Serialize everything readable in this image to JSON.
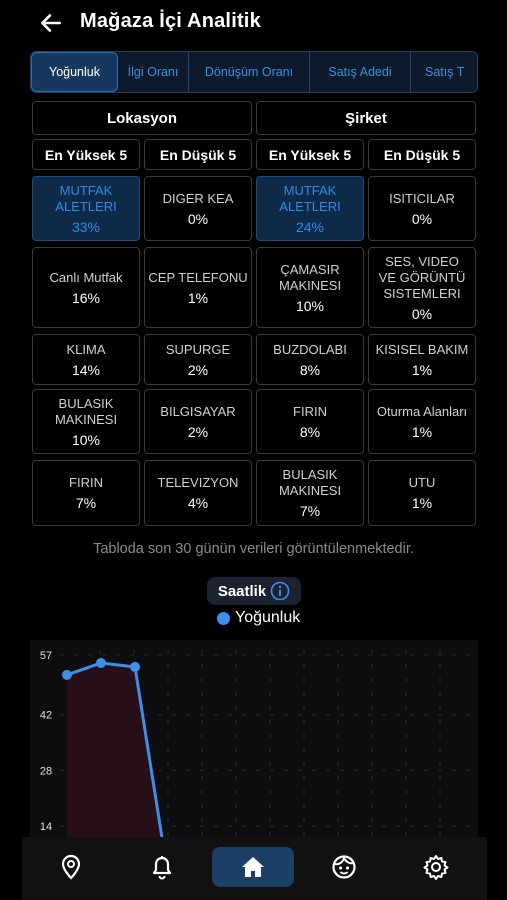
{
  "header": {
    "title": "Mağaza İçi Analitik"
  },
  "tabs": [
    {
      "label": "Yoğunluk",
      "active": true
    },
    {
      "label": "İlgi Oranı"
    },
    {
      "label": "Dönüşüm Oranı"
    },
    {
      "label": "Satış Adedi"
    },
    {
      "label": "Satış T"
    }
  ],
  "table": {
    "groups": [
      "Lokasyon",
      "Şirket"
    ],
    "subheads": [
      "En Yüksek 5",
      "En Düşük 5",
      "En Yüksek 5",
      "En Düşük 5"
    ],
    "rows": [
      [
        {
          "name": "MUTFAK\nALETLERI",
          "val": "33%",
          "hl": true
        },
        {
          "name": "DIGER KEA",
          "val": "0%"
        },
        {
          "name": "MUTFAK\nALETLERI",
          "val": "24%",
          "hl": true
        },
        {
          "name": "ISITICILAR",
          "val": "0%"
        }
      ],
      [
        {
          "name": "Canlı Mutfak",
          "val": "16%"
        },
        {
          "name": "CEP TELEFONU",
          "val": "1%"
        },
        {
          "name": "ÇAMASIR\nMAKINESI",
          "val": "10%"
        },
        {
          "name": "SES, VIDEO\nVE GÖRÜNTÜ\nSISTEMLERI",
          "val": "0%"
        }
      ],
      [
        {
          "name": "KLIMA",
          "val": "14%"
        },
        {
          "name": "SUPURGE",
          "val": "2%"
        },
        {
          "name": "BUZDOLABI",
          "val": "8%"
        },
        {
          "name": "KISISEL BAKIM",
          "val": "1%"
        }
      ],
      [
        {
          "name": "BULASIK\nMAKINESI",
          "val": "10%"
        },
        {
          "name": "BILGISAYAR",
          "val": "2%"
        },
        {
          "name": "FIRIN",
          "val": "8%"
        },
        {
          "name": "Oturma Alanları",
          "val": "1%"
        }
      ],
      [
        {
          "name": "FIRIN",
          "val": "7%"
        },
        {
          "name": "TELEVIZYON",
          "val": "4%"
        },
        {
          "name": "BULASIK\nMAKINESI",
          "val": "7%"
        },
        {
          "name": "UTU",
          "val": "1%"
        }
      ]
    ]
  },
  "note": "Tabloda son 30 günün verileri görüntülenmektedir.",
  "period": "Saatlik",
  "chart_data": {
    "type": "line",
    "series": [
      {
        "name": "Yoğunluk",
        "values": [
          52,
          55,
          54,
          0
        ]
      }
    ],
    "x": [
      0,
      1,
      2,
      3
    ],
    "yticks": [
      57,
      42,
      28,
      14
    ],
    "ylim": [
      0,
      57
    ],
    "color": "#3d8fe8"
  },
  "nav": [
    "location-icon",
    "bell-icon",
    "home-icon",
    "face-icon",
    "gear-icon"
  ]
}
